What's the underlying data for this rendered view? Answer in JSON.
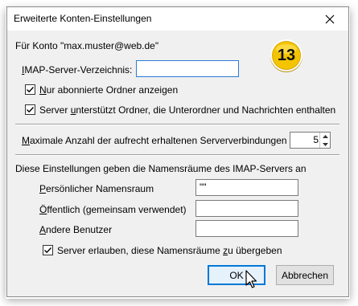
{
  "window": {
    "title": "Erweiterte Konten-Einstellungen",
    "close_glyph": "✕"
  },
  "account_label": "Für Konto \"max.muster@web.de\"",
  "badge": {
    "number": "13",
    "colors": {
      "fill": "#f5c400",
      "ring": "#ffffff",
      "shadow": "#b88a00"
    }
  },
  "imap_directory": {
    "label_underlined": "I",
    "label_rest": "MAP-Server-Verzeichnis:",
    "value": ""
  },
  "checkbox_subscribed": {
    "label_underlined": "N",
    "label_rest": "ur abonnierte Ordner anzeigen",
    "checked": true
  },
  "checkbox_server_support": {
    "label_before": "Server ",
    "label_underlined": "u",
    "label_after": "nterstützt Ordner, die Unterordner und Nachrichten enthalten",
    "checked": true
  },
  "max_connections": {
    "label_underlined": "M",
    "label_rest": "aximale Anzahl der aufrecht erhaltenen Serververbindungen",
    "value": "5"
  },
  "namespaces": {
    "intro": "Diese Einstellungen geben die Namensräume des IMAP-Servers an",
    "personal": {
      "label_underlined": "P",
      "label_rest": "ersönlicher Namensraum",
      "value": "\"\""
    },
    "public": {
      "label_underlined": "Ö",
      "label_rest": "ffentlich (gemeinsam verwendet)",
      "value": ""
    },
    "other_users": {
      "label_underlined": "A",
      "label_rest": "ndere Benutzer",
      "value": ""
    },
    "allow_override": {
      "label_before": "Server erlauben, diese Namensräume ",
      "label_underlined": "z",
      "label_after": "u übergeben",
      "checked": true
    }
  },
  "buttons": {
    "ok": "OK",
    "cancel": "Abbrechen"
  },
  "colors": {
    "dialog_bg": "#f0f0f0",
    "focus_blue": "#0078d7",
    "ok_button_bg": "#e5f1fb"
  }
}
